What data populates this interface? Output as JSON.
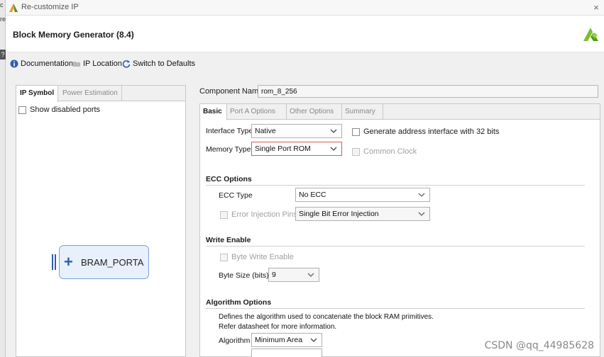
{
  "window": {
    "title": "Re-customize IP",
    "close_glyph": "×"
  },
  "left_edge": {
    "glyph_top": "c",
    "glyph_mid": "re",
    "glyph_q": "?"
  },
  "header": {
    "heading": "Block Memory Generator (8.4)"
  },
  "toolbar": {
    "documentation": "Documentation",
    "ip_location": "IP Location",
    "switch_defaults": "Switch to Defaults"
  },
  "left_panel": {
    "tabs": [
      "IP Symbol",
      "Power Estimation"
    ],
    "show_disabled_ports": "Show disabled ports",
    "bram_label": "BRAM_PORTA",
    "bram_plus": "+"
  },
  "right_panel": {
    "component_name_label": "Component Name",
    "component_name_value": "rom_8_256",
    "tabs": [
      "Basic",
      "Port A Options",
      "Other Options",
      "Summary"
    ],
    "interface_type_label": "Interface Type",
    "interface_type_value": "Native",
    "generate_address_label": "Generate address interface with 32 bits",
    "memory_type_label": "Memory Type",
    "memory_type_value": "Single Port ROM",
    "common_clock_label": "Common Clock",
    "ecc_section": "ECC Options",
    "ecc_type_label": "ECC Type",
    "ecc_type_value": "No ECC",
    "error_injection_label": "Error Injection Pins",
    "error_injection_value": "Single Bit Error Injection",
    "write_enable_section": "Write Enable",
    "byte_write_enable_label": "Byte Write Enable",
    "byte_size_label": "Byte Size (bits)",
    "byte_size_value": "9",
    "algorithm_section": "Algorithm Options",
    "algorithm_desc_1": "Defines the algorithm used to concatenate the block RAM primitives.",
    "algorithm_desc_2": "Refer datasheet for more information.",
    "algorithm_label": "Algorithm",
    "algorithm_value": "Minimum Area"
  },
  "watermark": "CSDN @qq_44985628",
  "colors": {
    "accent_blue": "#2b5fae",
    "highlight_red": "#d45a5a",
    "logo_green": "#7bbf2a"
  }
}
